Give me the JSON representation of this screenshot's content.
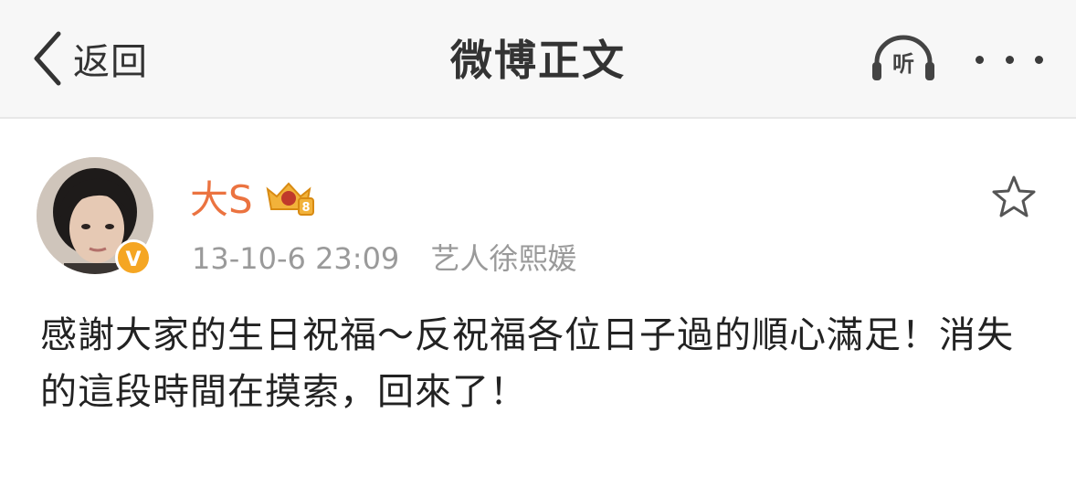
{
  "navbar": {
    "back_label": "返回",
    "title": "微博正文",
    "listen_label": "听",
    "more_icon": "more-dots-icon"
  },
  "post": {
    "author": "大S",
    "timestamp": "13-10-6 23:09",
    "source": "艺人徐熙媛",
    "verified_badge": "V",
    "content": "感謝大家的生日祝福～反祝福各位日子過的順心滿足！消失的這段時間在摸索，回來了！"
  },
  "colors": {
    "username": "#eb7340",
    "verify_badge": "#f5a623",
    "meta_text": "#9a9a9a",
    "navbar_bg": "#f7f7f7"
  }
}
